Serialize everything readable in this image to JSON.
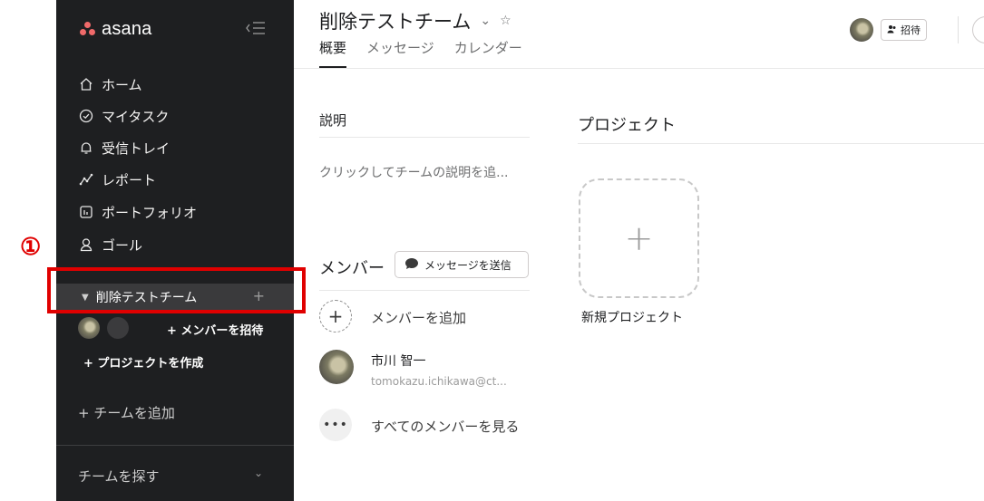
{
  "annotation": {
    "number": "①"
  },
  "sidebar": {
    "logo_text": "asana",
    "nav": [
      {
        "label": "ホーム",
        "icon": "home-icon"
      },
      {
        "label": "マイタスク",
        "icon": "check-circle-icon"
      },
      {
        "label": "受信トレイ",
        "icon": "bell-icon"
      },
      {
        "label": "レポート",
        "icon": "chart-line-icon"
      },
      {
        "label": "ポートフォリオ",
        "icon": "portfolio-icon"
      },
      {
        "label": "ゴール",
        "icon": "person-goal-icon"
      }
    ],
    "team": {
      "name": "削除テストチーム",
      "invite_label": "+ メンバーを招待",
      "create_project_label": "+ プロジェクトを作成"
    },
    "add_team_label": "+ チームを追加",
    "find_team_label": "チームを探す"
  },
  "header": {
    "title": "削除テストチーム",
    "tabs": [
      {
        "label": "概要",
        "active": true
      },
      {
        "label": "メッセージ",
        "active": false
      },
      {
        "label": "カレンダー",
        "active": false
      }
    ],
    "invite_label": "招待"
  },
  "description": {
    "label": "説明",
    "placeholder": "クリックしてチームの説明を追..."
  },
  "members": {
    "label": "メンバー",
    "send_message_label": "メッセージを送信",
    "add_member_label": "メンバーを追加",
    "list": [
      {
        "name": "市川 智一",
        "email": "tomokazu.ichikawa@ct..."
      }
    ],
    "see_all_label": "すべてのメンバーを見る"
  },
  "projects": {
    "label": "プロジェクト",
    "new_project_label": "新規プロジェクト"
  },
  "colors": {
    "sidebar_bg": "#1e1f21",
    "team_row_bg": "#3a3a3c",
    "annotation_red": "#e00000",
    "asana_logo": "#f06a6a"
  }
}
